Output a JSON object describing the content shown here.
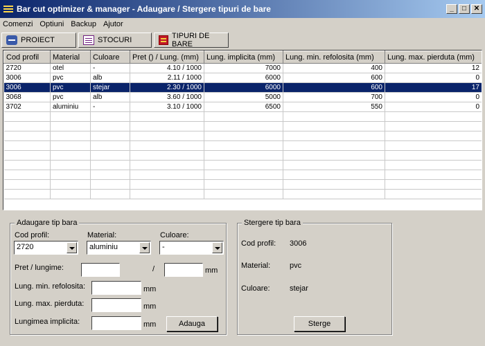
{
  "window": {
    "title": "Bar cut optimizer & manager - Adaugare / Stergere tipuri de bare",
    "min": "_",
    "max": "□",
    "close": "✕"
  },
  "menu": [
    {
      "label": "Comenzi"
    },
    {
      "label": "Optiuni"
    },
    {
      "label": "Backup"
    },
    {
      "label": "Ajutor"
    }
  ],
  "toolbar": [
    {
      "label": "PROIECT",
      "icon": "hand-icon"
    },
    {
      "label": "STOCURI",
      "icon": "document-icon"
    },
    {
      "label": "TIPURI DE BARE",
      "icon": "bars-icon"
    }
  ],
  "table": {
    "columns": [
      "Cod profil",
      "Material",
      "Culoare",
      "Pret () / Lung. (mm)",
      "Lung. implicita (mm)",
      "Lung. min. refolosita (mm)",
      "Lung. max. pierduta (mm)"
    ],
    "rows": [
      [
        "2720",
        "otel",
        "-",
        "4.10 / 1000",
        "7000",
        "400",
        "12"
      ],
      [
        "3006",
        "pvc",
        "alb",
        "2.11 / 1000",
        "6000",
        "600",
        "0"
      ],
      [
        "3006",
        "pvc",
        "stejar",
        "2.30 / 1000",
        "6000",
        "600",
        "17"
      ],
      [
        "3068",
        "pvc",
        "alb",
        "3.60 / 1000",
        "5000",
        "700",
        "0"
      ],
      [
        "3702",
        "aluminiu",
        "-",
        "3.10 / 1000",
        "6500",
        "550",
        "0"
      ]
    ],
    "selected_row": 2,
    "empty_rows": 9
  },
  "add_form": {
    "title": "Adaugare tip bara",
    "cod_label": "Cod profil:",
    "cod_value": "2720",
    "material_label": "Material:",
    "material_value": "aluminiu",
    "culoare_label": "Culoare:",
    "culoare_value": "-",
    "pret_label": "Pret / lungime:",
    "slash": "/",
    "mm": "mm",
    "min_label": "Lung. min. refolosita:",
    "max_label": "Lung. max. pierduta:",
    "impl_label": "Lungimea implicita:",
    "add_button": "Adauga"
  },
  "delete_form": {
    "title": "Stergere tip bara",
    "cod_label": "Cod profil:",
    "cod_value": "3006",
    "material_label": "Material:",
    "material_value": "pvc",
    "culoare_label": "Culoare:",
    "culoare_value": "stejar",
    "delete_button": "Sterge"
  },
  "colors": {
    "title_start": "#0a246a",
    "title_end": "#a6caf0",
    "selection": "#0a246a",
    "face": "#d4d0c8"
  }
}
